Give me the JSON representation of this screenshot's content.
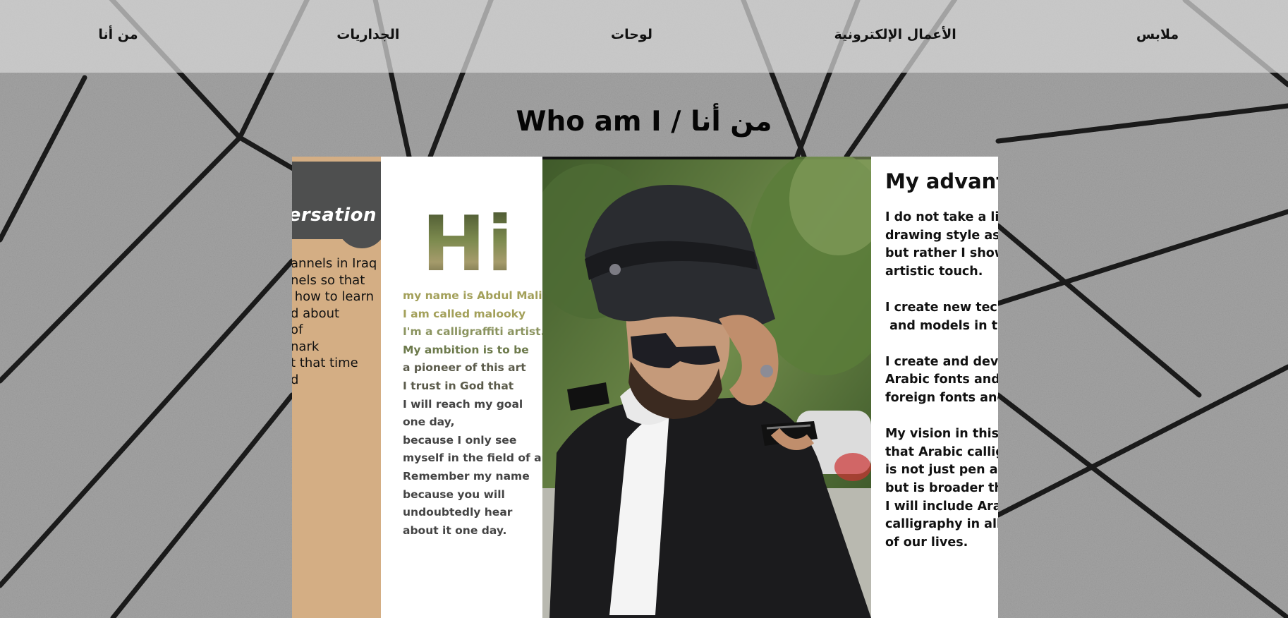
{
  "nav": {
    "items": [
      "من أنا",
      "الجداريات",
      "لوحات",
      "الأعمال الإلكترونية",
      "ملابس"
    ]
  },
  "page_title": "Who am I / من أنا",
  "cards": {
    "tan": {
      "title": "ersation",
      "lines": [
        "annels in Iraq",
        "",
        "nels so that",
        " how to learn",
        "d about",
        "of",
        "nark",
        "",
        "t that time",
        "d"
      ]
    },
    "hi": {
      "title": "Hi",
      "lines": [
        "my name is Abdul Malik",
        "I am called malooky",
        "I'm a calligraffiti artist.",
        "My ambition is to be",
        "a pioneer of this art",
        "I trust in God that",
        "I will reach my goal",
        "one day,",
        "because I only see",
        "myself in the field of art.",
        "Remember my name",
        "because you will",
        "undoubtedly hear",
        "about it one day."
      ]
    },
    "advantages": {
      "title": "My advanta",
      "lines": [
        "I do not take a line",
        "drawing style as i",
        "but rather I show",
        "artistic touch.",
        "",
        "I create new tech",
        " and models in thi",
        "",
        "I create and deve",
        "Arabic fonts and p",
        "foreign fonts and",
        "",
        "My vision in this a",
        "that Arabic callig",
        "is not just pen and",
        "but is broader tha",
        "I will include Arab",
        "calligraphy in all",
        "of our lives."
      ]
    }
  },
  "colors": {
    "nav_bg": "#d7d7d7",
    "tan_card": "#d4ae84",
    "blob": "#4e4f4f"
  }
}
